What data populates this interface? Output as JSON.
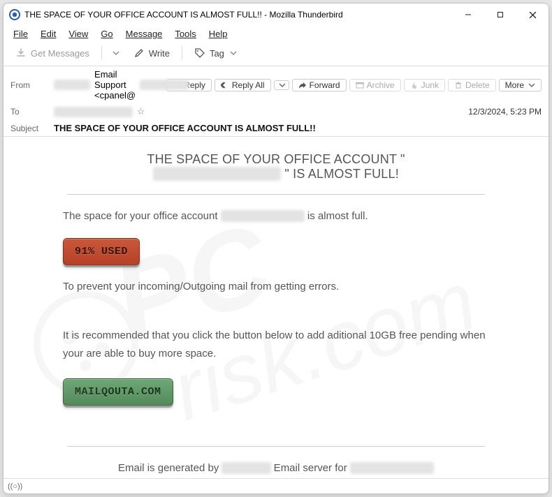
{
  "window": {
    "title": "THE SPACE OF YOUR OFFICE ACCOUNT IS ALMOST FULL!! - Mozilla Thunderbird"
  },
  "menu": {
    "file": "File",
    "edit": "Edit",
    "view": "View",
    "go": "Go",
    "message": "Message",
    "tools": "Tools",
    "help": "Help"
  },
  "toolbar": {
    "get_messages": "Get Messages",
    "write": "Write",
    "tag": "Tag"
  },
  "headers": {
    "from_label": "From",
    "from_name_redacted": "XXXXXX",
    "from_display": "Email Support <cpanel@",
    "from_domain_redacted": "XXXXXXXX",
    "from_close": ">",
    "to_label": "To",
    "to_redacted": "XXXXXXXXXXXXX",
    "subject_label": "Subject",
    "subject": "THE SPACE OF YOUR OFFICE ACCOUNT IS ALMOST FULL!!",
    "date": "12/3/2024, 5:23 PM"
  },
  "actions": {
    "reply": "Reply",
    "reply_all": "Reply All",
    "forward": "Forward",
    "archive": "Archive",
    "junk": "Junk",
    "delete": "Delete",
    "more": "More"
  },
  "mail": {
    "heading_line1": "THE SPACE OF YOUR OFFICE ACCOUNT \"",
    "heading_redacted": "XXXXXXXXXXXXXXX",
    "heading_line2": "\" IS ALMOST FULL!",
    "p1a": "The space for your office account ",
    "p1_redacted": "XXXXXXXXXXXX",
    "p1b": " is almost full.",
    "usage_button": "91% USED",
    "p2": "To prevent your incoming/Outgoing mail from getting errors.",
    "p3": "It is recommended that you click the button below to add aditional 10GB free pending when your are able to buy more space.",
    "cta_button": "MAILQOUTA.COM",
    "footer_a": "Email is generated by ",
    "footer_r1": "XXXXXXX",
    "footer_b": " Email server for ",
    "footer_r2": "XXXXXXXXXXXX"
  }
}
